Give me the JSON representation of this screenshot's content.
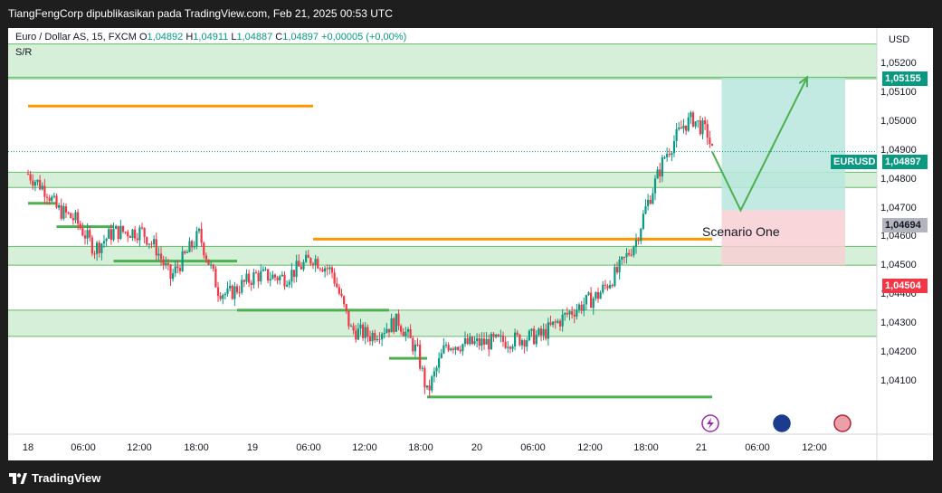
{
  "header": {
    "attribution": "TiangFengCorp dipublikasikan pada TradingView.com, Feb 21, 2025 00:53 UTC"
  },
  "footer": {
    "brand": "TradingView"
  },
  "legend": {
    "symbol": "Euro / Dollar AS, 15, FXCM",
    "o_label": "O",
    "o_value": "1,04892",
    "h_label": "H",
    "h_value": "1,04911",
    "l_label": "L",
    "l_value": "1,04887",
    "c_label": "C",
    "c_value": "1,04897",
    "change": "+0,00005 (+0,00%)",
    "indicator": "S/R"
  },
  "axis": {
    "currency": "USD",
    "price_ticks": [
      "1,05200",
      "1,05100",
      "1,05000",
      "1,04900",
      "1,04800",
      "1,04700",
      "1,04600",
      "1,04500",
      "1,04400",
      "1,04300",
      "1,04200",
      "1,04100"
    ],
    "time_ticks": [
      "18",
      "06:00",
      "12:00",
      "18:00",
      "19",
      "06:00",
      "12:00",
      "18:00",
      "20",
      "06:00",
      "12:00",
      "18:00",
      "21",
      "06:00",
      "12:00"
    ]
  },
  "price_markers": {
    "target": "1,05155",
    "symbol_tag": "EURUSD",
    "last": "1,04897",
    "entry": "1,04694",
    "stop": "1,04504"
  },
  "annotation": "Scenario One",
  "colors": {
    "up": "#089981",
    "down": "#f23645",
    "zone": "#d6efd8",
    "zone_border": "#4caf50",
    "orange": "#ff9800",
    "support": "#4caf50",
    "target_fill": "#b9e6dd",
    "stop_fill": "#f7cfd3",
    "arrow": "#4caf50",
    "background": "#ffffff"
  },
  "chart_data": {
    "type": "candlestick",
    "symbol": "EURUSD",
    "timeframe": "15",
    "yrange": [
      1.0402,
      1.0528
    ],
    "xrange": [
      "2025-02-18 00:00",
      "2025-02-21 14:00"
    ],
    "sr_zones": [
      [
        1.0515,
        1.0527
      ],
      [
        1.04773,
        1.04826
      ],
      [
        1.04504,
        1.04569
      ],
      [
        1.04257,
        1.04348
      ]
    ],
    "orange_levels": [
      {
        "value": 1.05055,
        "from": "2025-02-18 00:00",
        "to": "2025-02-19 06:00"
      },
      {
        "value": 1.04594,
        "from": "2025-02-19 06:00",
        "to": "2025-02-21 00:00"
      }
    ],
    "support_levels": [
      {
        "value": 1.04718,
        "from": "2025-02-18 00:00",
        "to": "2025-02-18 03:00"
      },
      {
        "value": 1.04637,
        "from": "2025-02-18 03:00",
        "to": "2025-02-18 09:00"
      },
      {
        "value": 1.04518,
        "from": "2025-02-18 09:00",
        "to": "2025-02-18 22:00"
      },
      {
        "value": 1.04348,
        "from": "2025-02-18 22:00",
        "to": "2025-02-19 14:00"
      },
      {
        "value": 1.04181,
        "from": "2025-02-19 14:00",
        "to": "2025-02-19 18:00"
      },
      {
        "value": 1.04047,
        "from": "2025-02-19 18:00",
        "to": "2025-02-21 00:00"
      }
    ],
    "position": {
      "entry": 1.04694,
      "target": 1.05155,
      "stop": 1.04504,
      "from": "2025-02-21 01:00",
      "to": "2025-02-21 14:00"
    },
    "scenario_path": [
      {
        "time": "2025-02-21 00:00",
        "price": 1.04897
      },
      {
        "time": "2025-02-21 03:00",
        "price": 1.04694
      },
      {
        "time": "2025-02-21 10:00",
        "price": 1.05155
      }
    ],
    "close_anchors": [
      {
        "time": "2025-02-18 00:00",
        "price": 1.0482
      },
      {
        "time": "2025-02-18 02:00",
        "price": 1.0476
      },
      {
        "time": "2025-02-18 03:00",
        "price": 1.047
      },
      {
        "time": "2025-02-18 05:00",
        "price": 1.0466
      },
      {
        "time": "2025-02-18 07:00",
        "price": 1.0456
      },
      {
        "time": "2025-02-18 09:00",
        "price": 1.0462
      },
      {
        "time": "2025-02-18 12:00",
        "price": 1.0462
      },
      {
        "time": "2025-02-18 13:30",
        "price": 1.0456
      },
      {
        "time": "2025-02-18 15:00",
        "price": 1.0446
      },
      {
        "time": "2025-02-18 17:00",
        "price": 1.0456
      },
      {
        "time": "2025-02-18 18:00",
        "price": 1.0461
      },
      {
        "time": "2025-02-18 20:00",
        "price": 1.0442
      },
      {
        "time": "2025-02-18 21:00",
        "price": 1.044
      },
      {
        "time": "2025-02-19 00:00",
        "price": 1.0447
      },
      {
        "time": "2025-02-19 03:00",
        "price": 1.0446
      },
      {
        "time": "2025-02-19 06:00",
        "price": 1.0453
      },
      {
        "time": "2025-02-19 08:00",
        "price": 1.0448
      },
      {
        "time": "2025-02-19 10:00",
        "price": 1.0428
      },
      {
        "time": "2025-02-19 12:00",
        "price": 1.0426
      },
      {
        "time": "2025-02-19 15:00",
        "price": 1.0431
      },
      {
        "time": "2025-02-19 17:00",
        "price": 1.042
      },
      {
        "time": "2025-02-19 18:00",
        "price": 1.0406
      },
      {
        "time": "2025-02-19 20:00",
        "price": 1.0423
      },
      {
        "time": "2025-02-19 22:00",
        "price": 1.0423
      },
      {
        "time": "2025-02-20 02:00",
        "price": 1.0424
      },
      {
        "time": "2025-02-20 06:00",
        "price": 1.0426
      },
      {
        "time": "2025-02-20 09:00",
        "price": 1.0434
      },
      {
        "time": "2025-02-20 12:00",
        "price": 1.044
      },
      {
        "time": "2025-02-20 14:00",
        "price": 1.0448
      },
      {
        "time": "2025-02-20 16:00",
        "price": 1.0459
      },
      {
        "time": "2025-02-20 17:00",
        "price": 1.047
      },
      {
        "time": "2025-02-20 19:00",
        "price": 1.0488
      },
      {
        "time": "2025-02-20 21:00",
        "price": 1.0499
      },
      {
        "time": "2025-02-20 22:00",
        "price": 1.0501
      },
      {
        "time": "2025-02-20 23:30",
        "price": 1.0496
      },
      {
        "time": "2025-02-21 00:00",
        "price": 1.04897
      }
    ]
  }
}
